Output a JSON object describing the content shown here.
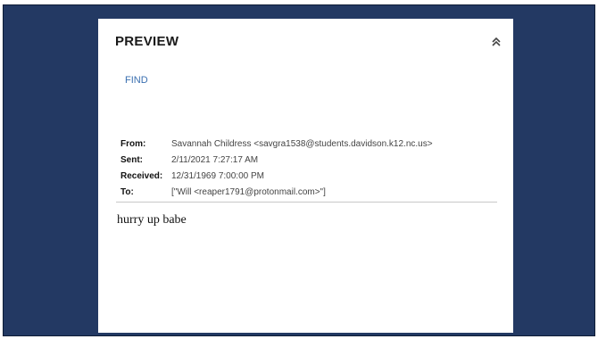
{
  "preview": {
    "title": "PREVIEW",
    "find_label": "FIND",
    "headers": [
      {
        "label": "From:",
        "value": "Savannah Childress <savgra1538@students.davidson.k12.nc.us>"
      },
      {
        "label": "Sent:",
        "value": "2/11/2021 7:27:17 AM"
      },
      {
        "label": "Received:",
        "value": "12/31/1969 7:00:00 PM"
      },
      {
        "label": "To:",
        "value": "[\"Will <reaper1791@protonmail.com>\"]"
      }
    ],
    "body": "hurry up babe",
    "collapse_icon": "chevron-double-up-icon"
  },
  "colors": {
    "background": "#233963",
    "panel": "#ffffff",
    "link": "#3a6fb0"
  }
}
